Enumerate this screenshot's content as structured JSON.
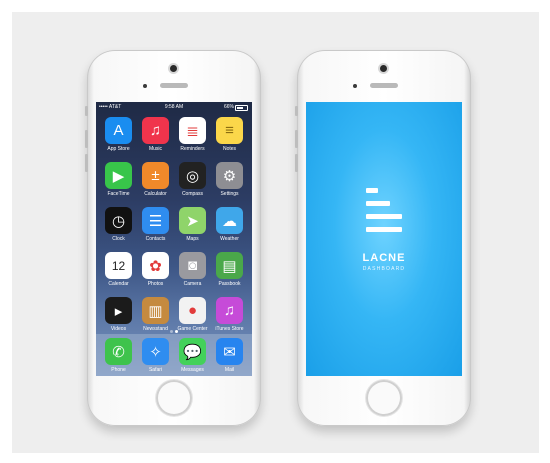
{
  "status_bar": {
    "carrier": "••••• AT&T",
    "time": "9:58 AM",
    "battery": "66%"
  },
  "apps": [
    {
      "label": "App Store",
      "icon": "app-store-icon",
      "color": "#1a8df0",
      "glyph": "A"
    },
    {
      "label": "Music",
      "icon": "music-icon",
      "color": "#f0344c",
      "glyph": "♫"
    },
    {
      "label": "Reminders",
      "icon": "reminders-icon",
      "color": "#ffffff",
      "glyph": "≣"
    },
    {
      "label": "Notes",
      "icon": "notes-icon",
      "color": "#fbd74a",
      "glyph": "≡"
    },
    {
      "label": "FaceTime",
      "icon": "facetime-icon",
      "color": "#38c54a",
      "glyph": "▶"
    },
    {
      "label": "Calculator",
      "icon": "calculator-icon",
      "color": "#f0892a",
      "glyph": "±"
    },
    {
      "label": "Compass",
      "icon": "compass-icon",
      "color": "#222222",
      "glyph": "◎"
    },
    {
      "label": "Settings",
      "icon": "settings-icon",
      "color": "#8e8e93",
      "glyph": "⚙"
    },
    {
      "label": "Clock",
      "icon": "clock-icon",
      "color": "#111111",
      "glyph": "◷"
    },
    {
      "label": "Contacts",
      "icon": "contacts-icon",
      "color": "#2f8df0",
      "glyph": "☰"
    },
    {
      "label": "Maps",
      "icon": "maps-icon",
      "color": "#8fd46a",
      "glyph": "➤"
    },
    {
      "label": "Weather",
      "icon": "weather-icon",
      "color": "#3fa7ea",
      "glyph": "☁"
    },
    {
      "label": "Calendar",
      "icon": "calendar-icon",
      "color": "#ffffff",
      "glyph": "12"
    },
    {
      "label": "Photos",
      "icon": "photos-icon",
      "color": "#ffffff",
      "glyph": "✿"
    },
    {
      "label": "Camera",
      "icon": "camera-icon",
      "color": "#9a9a9f",
      "glyph": "◙"
    },
    {
      "label": "Passbook",
      "icon": "passbook-icon",
      "color": "#4aa84a",
      "glyph": "▤"
    },
    {
      "label": "Videos",
      "icon": "videos-icon",
      "color": "#1b1b1b",
      "glyph": "▸"
    },
    {
      "label": "Newsstand",
      "icon": "newsstand-icon",
      "color": "#c58a3f",
      "glyph": "▥"
    },
    {
      "label": "Game Center",
      "icon": "game-center-icon",
      "color": "#f2f2f2",
      "glyph": "●"
    },
    {
      "label": "iTunes Store",
      "icon": "itunes-store-icon",
      "color": "#c64bd8",
      "glyph": "♫"
    }
  ],
  "dock": [
    {
      "label": "Phone",
      "icon": "phone-icon",
      "color": "#3ec34c",
      "glyph": "✆"
    },
    {
      "label": "Safari",
      "icon": "safari-icon",
      "color": "#2f8df0",
      "glyph": "✧"
    },
    {
      "label": "Messages",
      "icon": "messages-icon",
      "color": "#43d15a",
      "glyph": "💬"
    },
    {
      "label": "Mail",
      "icon": "mail-icon",
      "color": "#2784ef",
      "glyph": "✉"
    }
  ],
  "page_indicator": {
    "pages": 2,
    "current": 1
  },
  "lacne": {
    "title": "LACNE",
    "subtitle": "DASHBOARD",
    "background": "#27aaf0"
  }
}
